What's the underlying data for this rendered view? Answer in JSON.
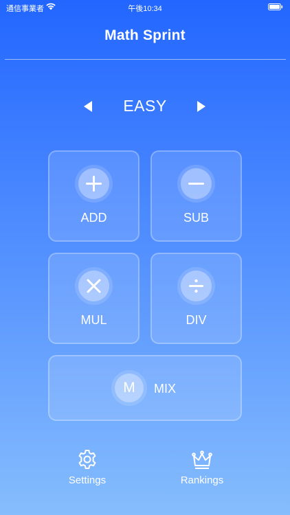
{
  "status_bar": {
    "carrier": "通信事業者",
    "time": "午後10:34"
  },
  "header": {
    "title": "Math Sprint"
  },
  "difficulty": {
    "label": "EASY",
    "prev_icon": "triangle-left-icon",
    "next_icon": "triangle-right-icon"
  },
  "operations": [
    {
      "label": "ADD",
      "icon": "plus-icon"
    },
    {
      "label": "SUB",
      "icon": "minus-icon"
    },
    {
      "label": "MUL",
      "icon": "times-icon"
    },
    {
      "label": "DIV",
      "icon": "divide-icon"
    }
  ],
  "mix": {
    "badge": "M",
    "label": "MIX"
  },
  "bottom_nav": {
    "settings": {
      "label": "Settings",
      "icon": "gear-icon"
    },
    "rankings": {
      "label": "Rankings",
      "icon": "crown-icon"
    }
  },
  "colors": {
    "gradient_top": "#2266ff",
    "gradient_bottom": "#86bdfd",
    "text": "#ffffff"
  }
}
